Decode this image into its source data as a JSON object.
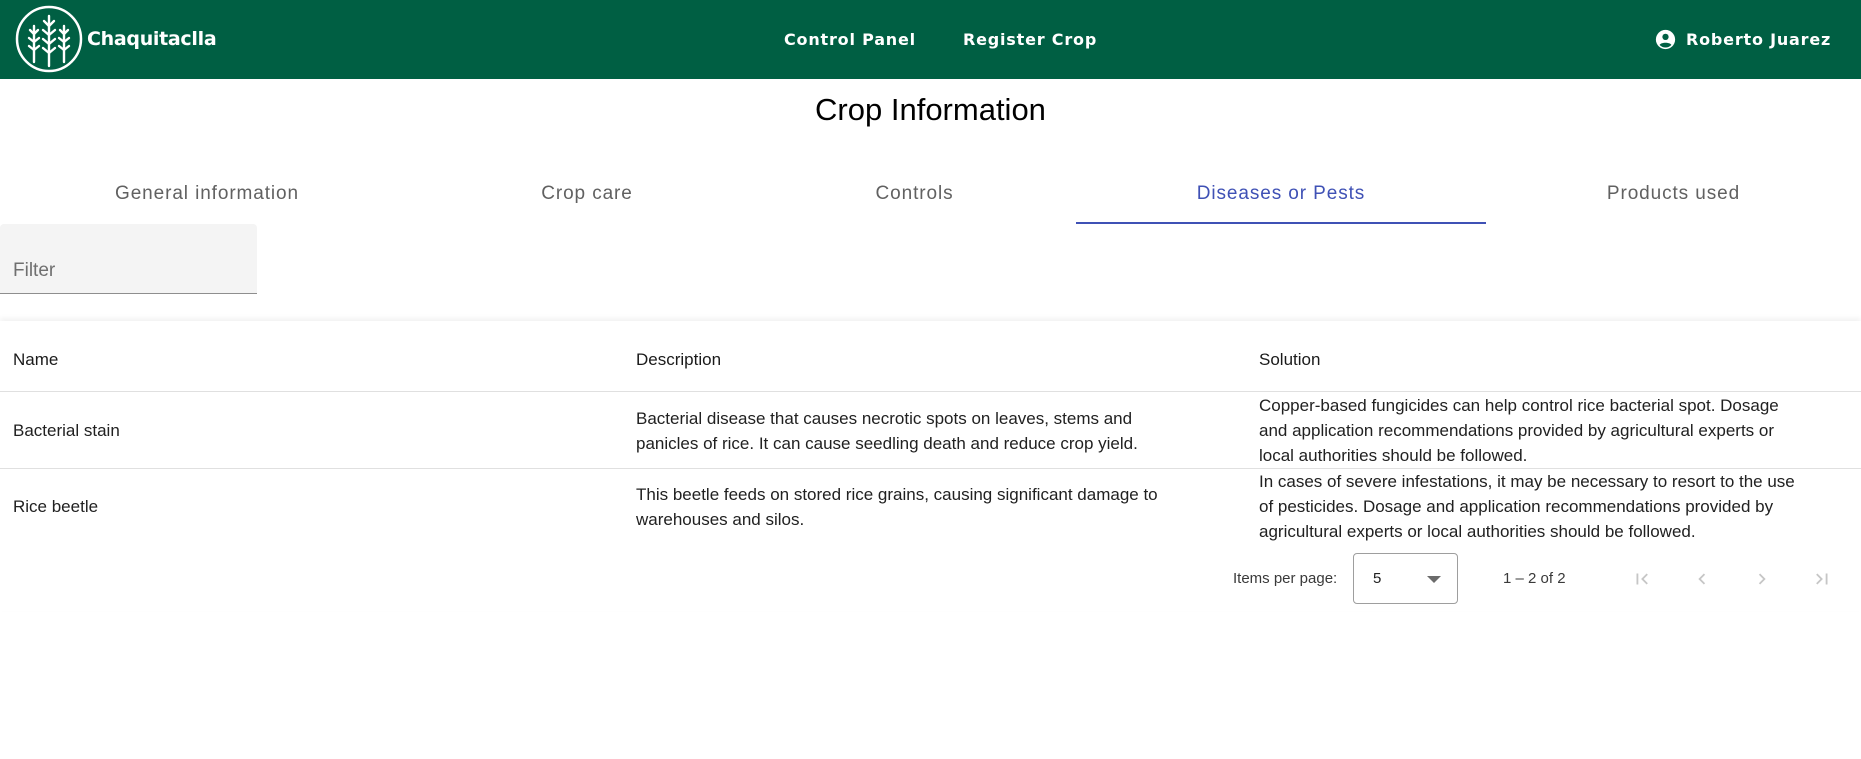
{
  "navbar": {
    "brand": "Chaquitaclla",
    "links": {
      "control_panel": "Control Panel",
      "register_crop": "Register Crop"
    },
    "user_name": "Roberto Juarez",
    "icons": {
      "logo": "wheat-logo-icon",
      "user": "account-circle-icon"
    }
  },
  "page": {
    "title": "Crop Information"
  },
  "tabs": {
    "general": "General information",
    "care": "Crop care",
    "controls": "Controls",
    "diseases": "Diseases or Pests",
    "products": "Products used",
    "active": "diseases"
  },
  "filter": {
    "placeholder": "Filter",
    "value": ""
  },
  "table": {
    "columns": {
      "name": "Name",
      "description": "Description",
      "solution": "Solution"
    },
    "rows": [
      {
        "name": "Bacterial stain",
        "description_lines": [
          "Bacterial disease that causes necrotic spots on leaves, stems and",
          "panicles of rice. It can cause seedling death and reduce crop yield."
        ],
        "solution_lines": [
          "Copper-based fungicides can help control rice bacterial spot. Dosage",
          "and application recommendations provided by agricultural experts or",
          "local authorities should be followed."
        ]
      },
      {
        "name": "Rice beetle",
        "description_lines": [
          "This beetle feeds on stored rice grains, causing significant damage to",
          "warehouses and silos."
        ],
        "solution_lines": [
          "In cases of severe infestations, it may be necessary to resort to the use",
          "of pesticides. Dosage and application recommendations provided by",
          "agricultural experts or local authorities should be followed."
        ]
      }
    ]
  },
  "paginator": {
    "items_per_page_label": "Items per page:",
    "items_per_page": "5",
    "range": "1 – 2 of 2",
    "icons": [
      "first-page-icon",
      "previous-page-icon",
      "next-page-icon",
      "last-page-icon"
    ]
  },
  "colors": {
    "navbar_bg": "#005f43",
    "accent": "#3f51b5",
    "tab_text": "#616161",
    "disabled_icon": "#c6c6c6"
  }
}
